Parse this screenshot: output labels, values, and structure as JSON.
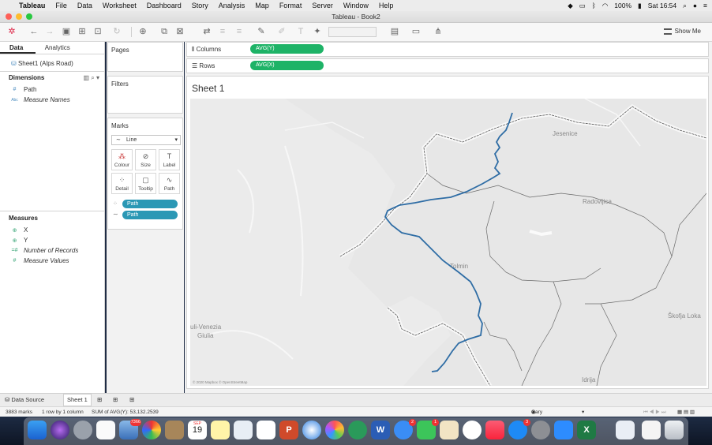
{
  "menubar": {
    "app": "Tableau",
    "items": [
      "File",
      "Data",
      "Worksheet",
      "Dashboard",
      "Story",
      "Analysis",
      "Map",
      "Format",
      "Server",
      "Window",
      "Help"
    ],
    "battery": "100%",
    "clock": "Sat 16:54"
  },
  "window": {
    "title": "Tableau - Book2"
  },
  "toolbar": {
    "show_me": "Show Me"
  },
  "data_pane": {
    "tabs": [
      "Data",
      "Analytics"
    ],
    "source": "Sheet1 (Alps Road)",
    "dimensions_header": "Dimensions",
    "dimensions": [
      {
        "icon": "#",
        "label": "Path"
      },
      {
        "icon": "Abc",
        "label": "Measure Names"
      }
    ],
    "measures_header": "Measures",
    "measures": [
      {
        "icon": "globe",
        "label": "X"
      },
      {
        "icon": "globe",
        "label": "Y"
      },
      {
        "icon": "=#",
        "label": "Number of Records"
      },
      {
        "icon": "#",
        "label": "Measure Values"
      }
    ]
  },
  "cards": {
    "pages": "Pages",
    "filters": "Filters",
    "marks": "Marks",
    "mark_type": "Line",
    "mark_buttons": [
      "Colour",
      "Size",
      "Label",
      "Detail",
      "Tooltip",
      "Path"
    ],
    "mark_pills": [
      "Path",
      "Path"
    ]
  },
  "shelves": {
    "columns_label": "Columns",
    "columns_pill": "AVG(Y)",
    "rows_label": "Rows",
    "rows_pill": "AVG(X)"
  },
  "sheet": {
    "title": "Sheet 1",
    "map_labels": [
      "Jesenice",
      "Radovljica",
      "Tolmin",
      "uli-Venezia",
      "Giulia",
      "Škofja Loka",
      "Idrija"
    ],
    "attribution": "© 2020 Mapbox © OpenStreetMap"
  },
  "sheet_tabs": {
    "data_source": "Data Source",
    "sheet": "Sheet 1"
  },
  "status": {
    "marks": "3883 marks",
    "rows_cols": "1 row by 1 column",
    "sum": "SUM of AVG(Y): 53,132.2539",
    "user": "Gary Collins"
  },
  "dock": {
    "badges": {
      "photos": "7366",
      "messages": "2",
      "facetime": "1",
      "appstore": "3"
    },
    "calendar_month": "SEP",
    "calendar_day": "19"
  },
  "colors": {
    "pill_blue": "#2b98b5",
    "pill_green": "#1eb367",
    "route": "#2f6da5",
    "map_bg": "#e6e6e6"
  }
}
